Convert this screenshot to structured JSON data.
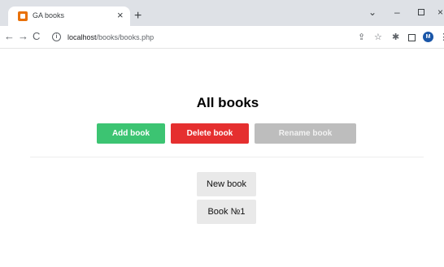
{
  "browser": {
    "tab_title": "GA books",
    "tab_close": "×",
    "new_tab": "+",
    "window": {
      "chevron": "⌄",
      "minimize": "–",
      "close": "×"
    },
    "nav": {
      "back": "←",
      "forward": "→",
      "reload": "C"
    },
    "info_icon": "i",
    "url_host": "localhost",
    "url_path": "/books/books.php",
    "toolbar_icons": {
      "share": "⇪",
      "star": "☆",
      "extensions": "✱",
      "menu": "⋮"
    },
    "avatar_letter": "M",
    "avatar_color": "#1a56a8",
    "favicon_color": "#e8710a"
  },
  "page": {
    "heading": "All books",
    "buttons": {
      "add": "Add book",
      "delete": "Delete book",
      "rename": "Rename book"
    },
    "button_colors": {
      "add": "#3cc472",
      "delete": "#e52f2f",
      "rename": "#bdbdbd"
    },
    "books": [
      "New book",
      "Book №1"
    ]
  }
}
